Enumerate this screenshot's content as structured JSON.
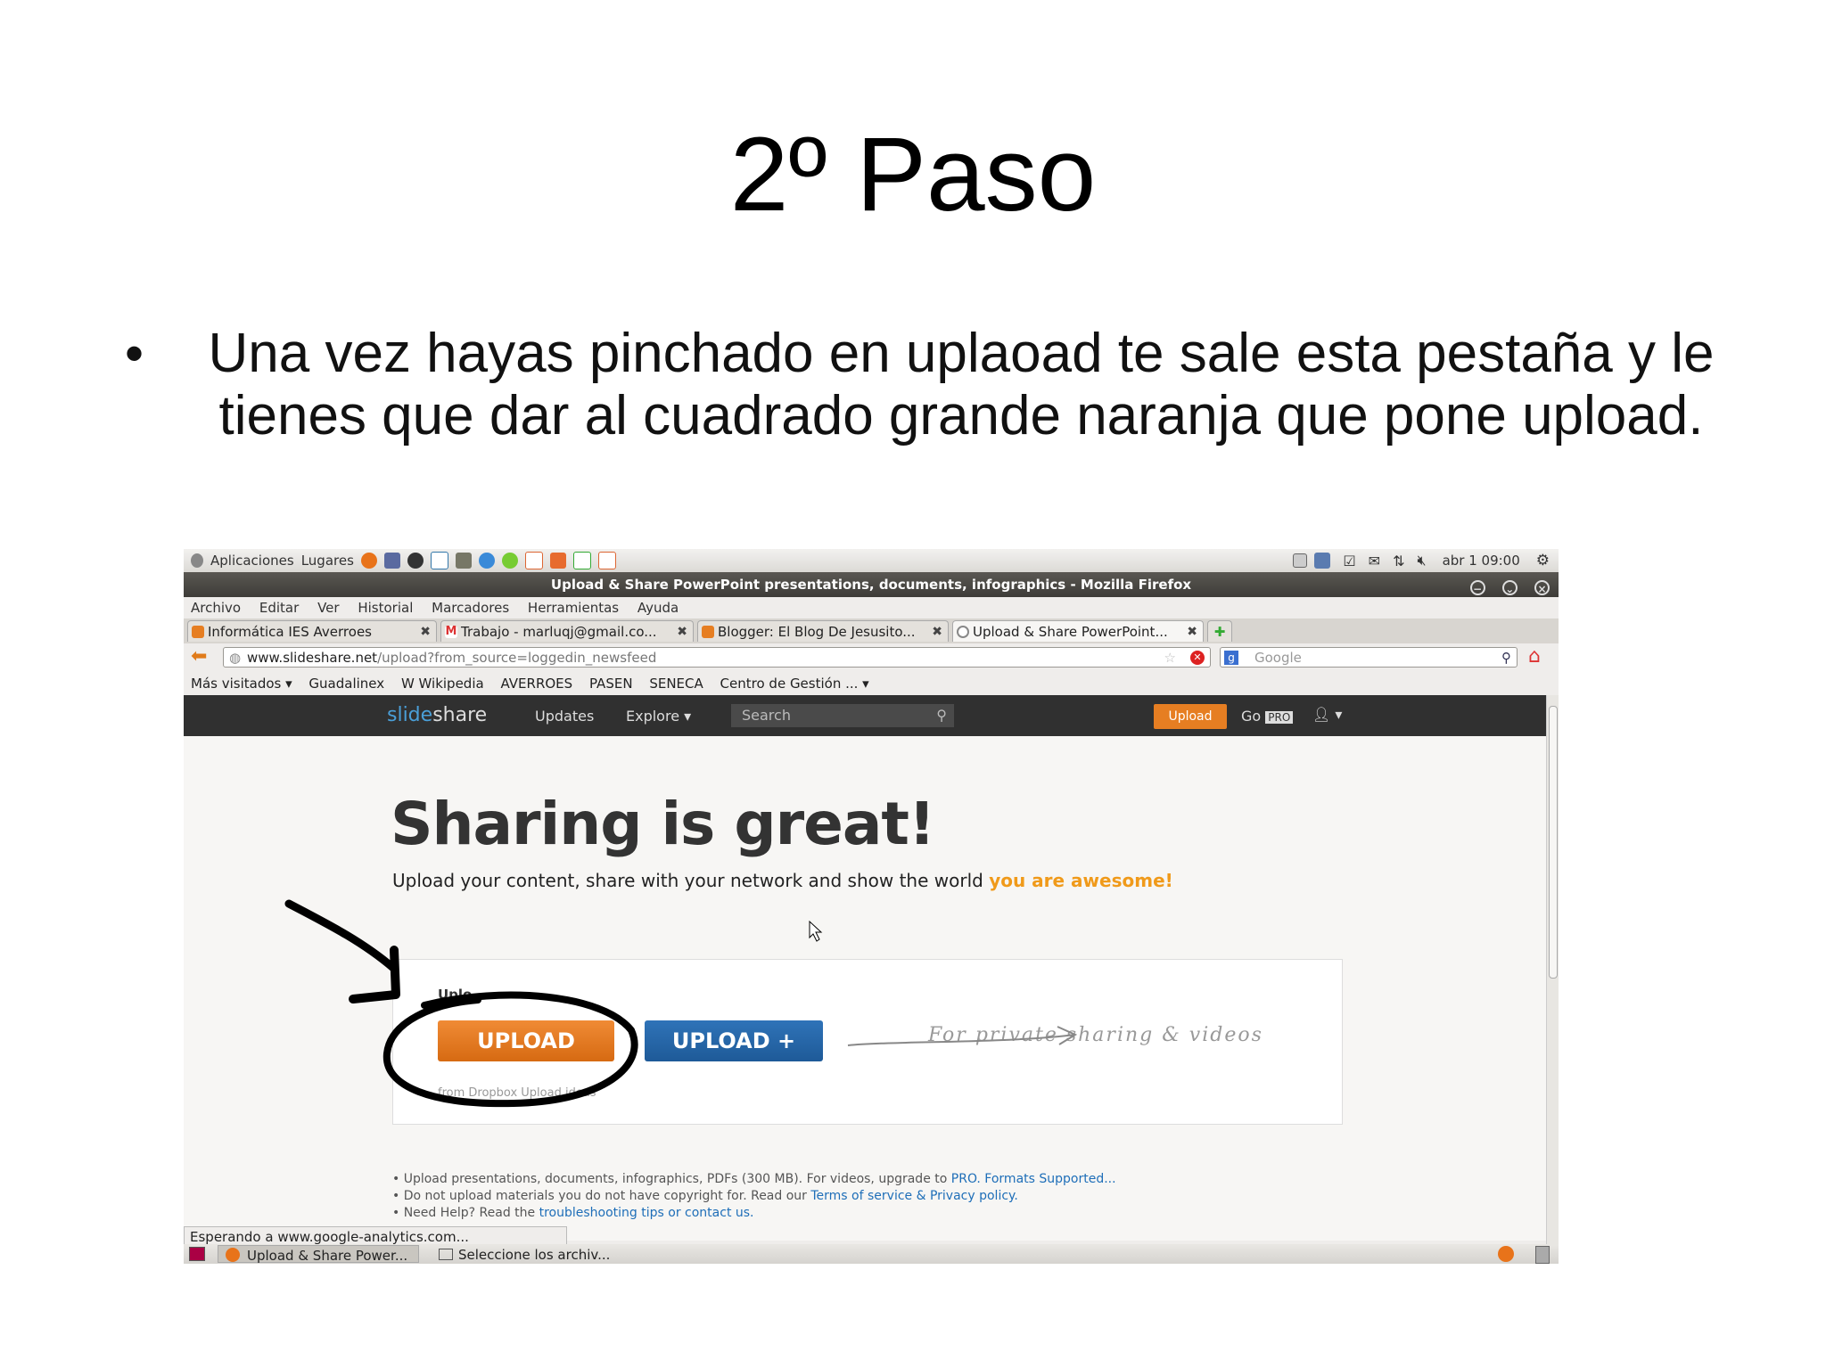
{
  "slide": {
    "title": "2º Paso",
    "bullet": "Una vez hayas pinchado en uplaoad te sale esta pestaña y le tienes que dar al cuadrado grande naranja que pone upload."
  },
  "gnome": {
    "apps": "Aplicaciones",
    "places": "Lugares",
    "clock": "abr 1 09:00"
  },
  "window": {
    "title": "Upload & Share PowerPoint presentations, documents, infographics - Mozilla Firefox"
  },
  "menu": [
    "Archivo",
    "Editar",
    "Ver",
    "Historial",
    "Marcadores",
    "Herramientas",
    "Ayuda"
  ],
  "tabs": [
    {
      "label": "Informática IES Averroes",
      "color": "#e67e22"
    },
    {
      "label": "Trabajo - marluqj@gmail.co...",
      "color": "#d33"
    },
    {
      "label": "Blogger: El Blog De Jesusito...",
      "color": "#e67e22"
    },
    {
      "label": "Upload & Share PowerPoint...",
      "color": "#888"
    }
  ],
  "nav": {
    "url_domain": "www.slideshare.net",
    "url_path": "/upload?from_source=loggedin_newsfeed",
    "search_placeholder": "Google"
  },
  "bookmarks": [
    "Más visitados ▾",
    "Guadalinex",
    "W Wikipedia",
    "AVERROES",
    "PASEN",
    "SENECA",
    "Centro de Gestión ... ▾"
  ],
  "slideshare": {
    "logo_a": "slide",
    "logo_b": "share",
    "updates": "Updates",
    "explore": "Explore ▾",
    "search_placeholder": "Search",
    "upload_btn": "Upload",
    "gopro": "Go",
    "pro_badge": "PRO"
  },
  "page": {
    "hero_title": "Sharing is great!",
    "hero_sub": "Upload your content, share with your network and show the world",
    "hero_highlight": "you are awesome!",
    "card_label": "Uplo",
    "upload_btn": "UPLOAD",
    "upload_plus_btn": "UPLOAD +",
    "private_note": "For private sharing & videos",
    "card_foot": "from Dropbox      Upload ideas",
    "notes": [
      {
        "text": "• Upload presentations, documents, infographics, PDFs (300 MB). For videos, upgrade to ",
        "link": "PRO. Formats Supported..."
      },
      {
        "text": "• Do not upload materials you do not have copyright for. Read our ",
        "link": "Terms of service & Privacy policy."
      },
      {
        "text": "• Need Help? Read the ",
        "link": "troubleshooting tips or contact us."
      }
    ]
  },
  "status": "Esperando a www.google-analytics.com...",
  "taskbar": [
    "Upload & Share Power...",
    "Seleccione los archiv..."
  ]
}
